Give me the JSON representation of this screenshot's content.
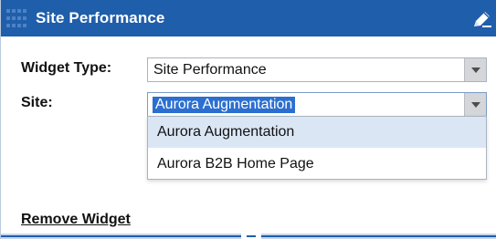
{
  "widget": {
    "title": "Site Performance",
    "header_icon": "edit-pencil-icon"
  },
  "form": {
    "widget_type": {
      "label": "Widget Type:",
      "value": "Site Performance"
    },
    "site": {
      "label": "Site:",
      "value": "Aurora Augmentation",
      "options": [
        "Aurora Augmentation",
        "Aurora B2B Home Page"
      ]
    }
  },
  "actions": {
    "remove_label": "Remove Widget"
  },
  "colors": {
    "header": "#1f5eaa",
    "selection": "#2b6fd0",
    "option_highlight": "#dbe6f5"
  }
}
